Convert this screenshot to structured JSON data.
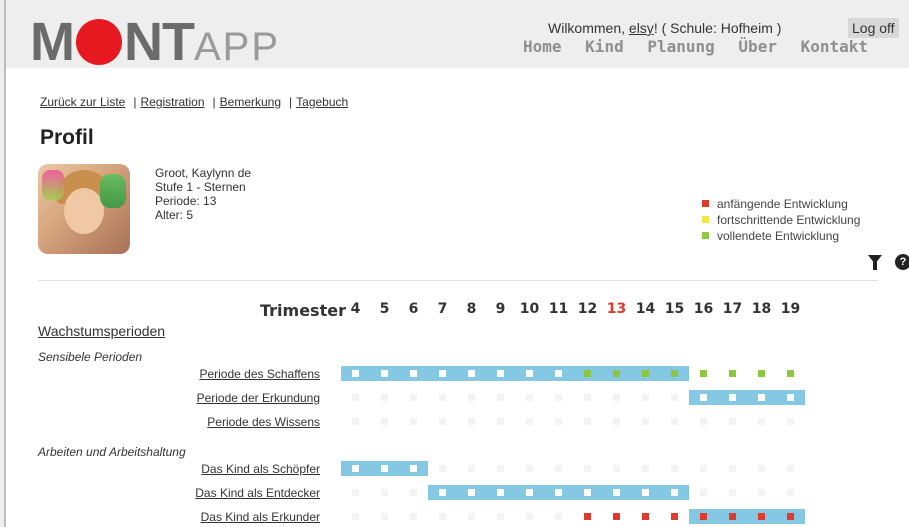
{
  "header": {
    "logo_text_a": "M",
    "logo_text_b": "NT",
    "logo_text_app": "APP",
    "welcome_prefix": "Wilkommen, ",
    "user": "elsy",
    "welcome_suffix": "! ( Schule: Hofheim )",
    "logoff_label": "Log off",
    "nav": [
      "Home",
      "Kind",
      "Planung",
      "Über",
      "Kontakt"
    ]
  },
  "subnav": {
    "items": [
      "Zurück zur Liste",
      "Registration",
      "Bemerkung",
      "Tagebuch"
    ]
  },
  "page_title": "Profil",
  "child": {
    "name": "Groot, Kaylynn de",
    "level": "Stufe 1 - Sternen",
    "period": "Periode: 13",
    "age": "Alter: 5"
  },
  "legend": [
    {
      "label": "anfängende Entwicklung",
      "color": "#e03a2f"
    },
    {
      "label": "fortschrittende Entwicklung",
      "color": "#f2e64c"
    },
    {
      "label": "vollendete Entwicklung",
      "color": "#8dc63f"
    }
  ],
  "icons": {
    "filter": "filter-icon",
    "help": "help-icon",
    "help_glyph": "?"
  },
  "timeline": {
    "label": "Trimester",
    "trimesters": [
      4,
      5,
      6,
      7,
      8,
      9,
      10,
      11,
      12,
      13,
      14,
      15,
      16,
      17,
      18,
      19
    ],
    "current": 13,
    "current_color": "#e03a2f",
    "bar_color": "#84c8e4"
  },
  "growth": {
    "title": "Wachstumsperioden",
    "groups": [
      {
        "label": "Sensibele Perioden",
        "rows": [
          {
            "label": "Periode des Schaffens",
            "bar": [
              4,
              15
            ],
            "cells": {
              "white": [
                4,
                5,
                6,
                7,
                8,
                9,
                10,
                11
              ],
              "green": [
                12,
                13,
                14,
                15,
                16,
                17,
                18,
                19
              ]
            }
          },
          {
            "label": "Periode der Erkundung",
            "bar": [
              16,
              19
            ],
            "cells": {
              "white": [
                16,
                17,
                18,
                19
              ]
            }
          },
          {
            "label": "Periode des Wissens",
            "bar": null,
            "cells": {}
          }
        ]
      },
      {
        "label": "Arbeiten und Arbeitshaltung",
        "rows": [
          {
            "label": "Das Kind als Schöpfer",
            "bar": [
              4,
              6
            ],
            "cells": {
              "white": [
                4,
                5,
                6
              ]
            }
          },
          {
            "label": "Das Kind als Entdecker",
            "bar": [
              7,
              15
            ],
            "cells": {
              "white": [
                7,
                8,
                9,
                10,
                11,
                12,
                13,
                14,
                15
              ]
            }
          },
          {
            "label": "Das Kind als Erkunder",
            "bar": [
              16,
              19
            ],
            "cells": {
              "red": [
                12,
                13,
                14,
                15,
                16,
                17,
                18,
                19
              ]
            }
          }
        ]
      }
    ]
  }
}
